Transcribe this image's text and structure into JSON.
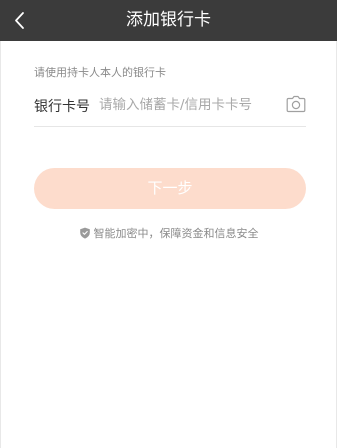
{
  "nav": {
    "title": "添加银行卡",
    "back_icon": "chevron-left-icon"
  },
  "form": {
    "hint": "请使用持卡人本人的银行卡",
    "card_label": "银行卡号",
    "card_value": "",
    "card_placeholder": "请输入储蓄卡/信用卡卡号",
    "camera_icon": "camera-icon"
  },
  "actions": {
    "next_label": "下一步",
    "next_color": "#fddccc"
  },
  "footer": {
    "security_text": "智能加密中，保障资金和信息安全",
    "shield_icon": "shield-icon"
  },
  "colors": {
    "nav_background": "#3b3b3b",
    "page_background": "#ffffff"
  }
}
